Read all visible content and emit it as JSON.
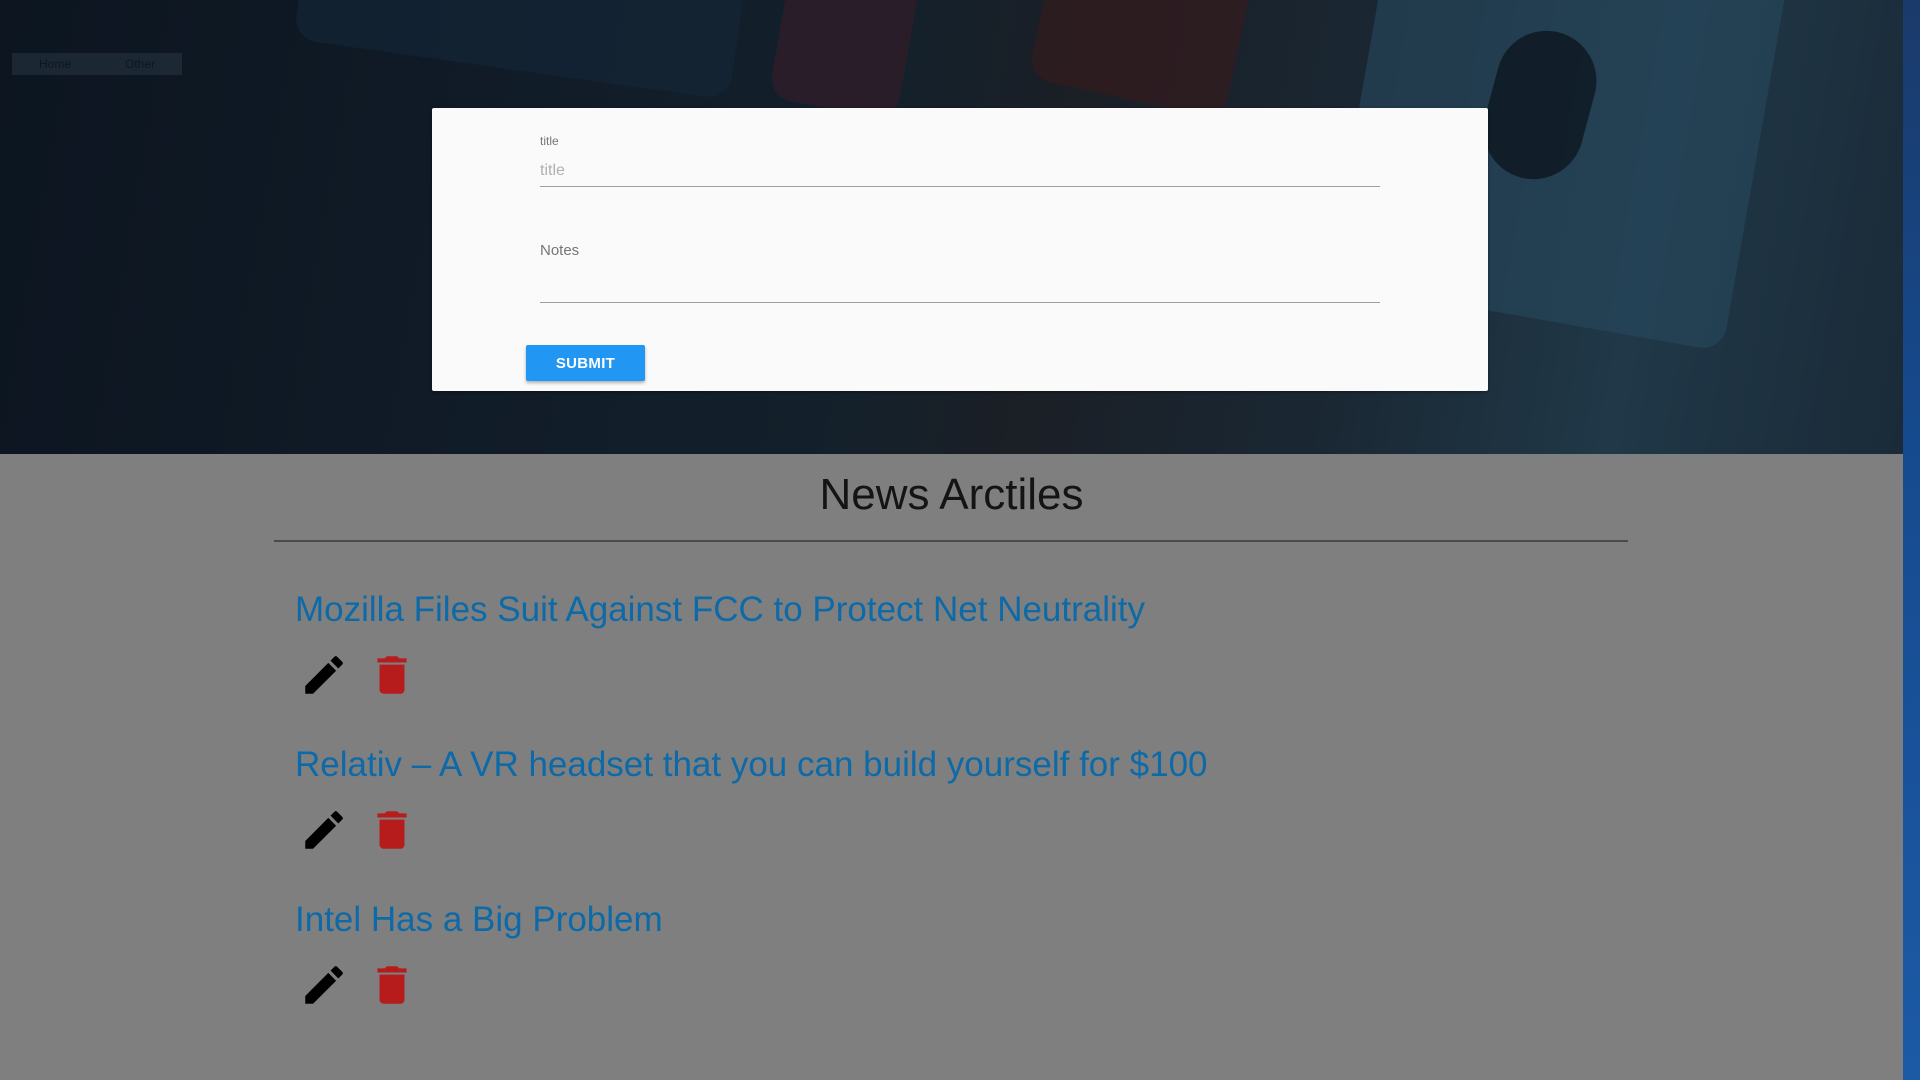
{
  "nav": {
    "items": [
      "Home",
      "Other"
    ]
  },
  "form": {
    "title_label": "title",
    "title_placeholder": "title",
    "title_value": "",
    "notes_label": "Notes",
    "notes_value": "",
    "submit_label": "SUBMIT"
  },
  "news": {
    "heading": "News Arctiles",
    "articles": [
      {
        "title": "Mozilla Files Suit Against FCC to Protect Net Neutrality"
      },
      {
        "title": "Relativ – A VR headset that you can build yourself for $100"
      },
      {
        "title": "Intel Has a Big Problem"
      }
    ]
  },
  "icons": {
    "edit": "pencil-icon",
    "delete": "trash-icon"
  },
  "colors": {
    "submit": "#2196f3",
    "link": "#0d6aa8",
    "delete": "#b71c1c",
    "edit": "#000000",
    "page_bg": "#7f7f7f"
  }
}
